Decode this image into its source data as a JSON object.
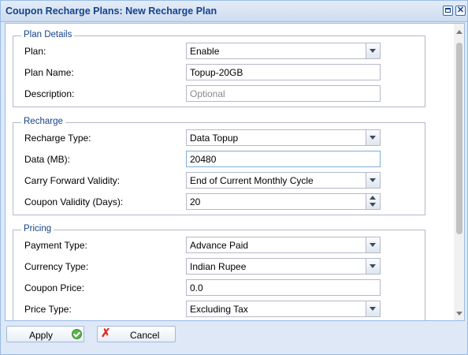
{
  "window": {
    "title": "Coupon Recharge Plans: New Recharge Plan",
    "tools": {
      "maximize": "maximize-icon",
      "close": "✕"
    }
  },
  "plan_details": {
    "legend": "Plan Details",
    "plan_label": "Plan:",
    "plan_value": "Enable",
    "plan_name_label": "Plan Name:",
    "plan_name_value": "Topup-20GB",
    "description_label": "Description:",
    "description_placeholder": "Optional"
  },
  "recharge": {
    "legend": "Recharge",
    "recharge_type_label": "Recharge Type:",
    "recharge_type_value": "Data Topup",
    "data_label": "Data (MB):",
    "data_value": "20480",
    "carry_forward_label": "Carry Forward Validity:",
    "carry_forward_value": "End of Current Monthly Cycle",
    "coupon_validity_label": "Coupon Validity (Days):",
    "coupon_validity_value": "20"
  },
  "pricing": {
    "legend": "Pricing",
    "payment_type_label": "Payment Type:",
    "payment_type_value": "Advance Paid",
    "currency_type_label": "Currency Type:",
    "currency_type_value": "Indian Rupee",
    "coupon_price_label": "Coupon Price:",
    "coupon_price_value": "0.0",
    "price_type_label": "Price Type:",
    "price_type_value": "Excluding Tax"
  },
  "footer": {
    "apply_label": "Apply",
    "cancel_label": "Cancel"
  },
  "colors": {
    "title_text": "#15428b",
    "frame_bg": "#dfe8f6",
    "frame_border": "#99bbe8",
    "apply_icon": "#58b24a",
    "cancel_icon": "#d8312b"
  }
}
